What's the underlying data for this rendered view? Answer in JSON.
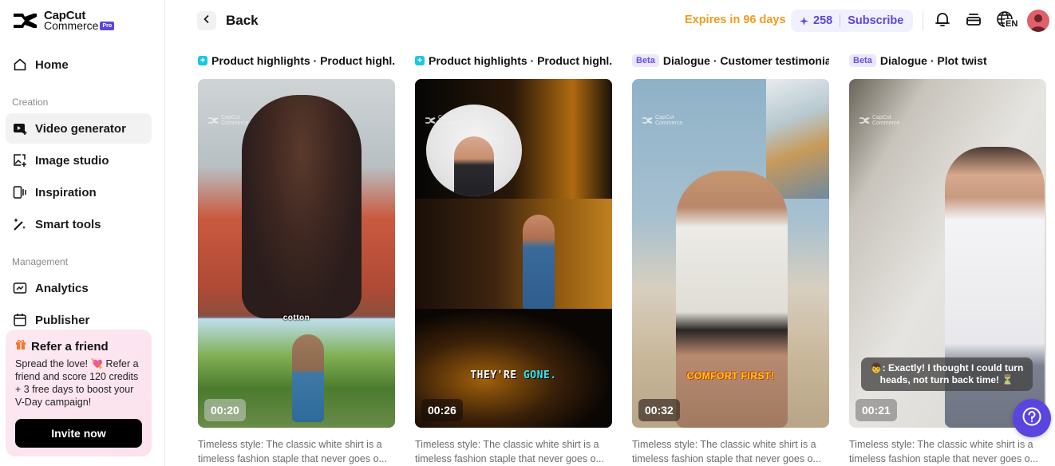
{
  "brand": {
    "name_line1": "CapCut",
    "name_line2": "Commerce",
    "badge": "Pro"
  },
  "sidebar": {
    "home": {
      "label": "Home",
      "icon": "home-icon"
    },
    "sections": [
      {
        "title": "Creation"
      },
      {
        "title": "Management"
      }
    ],
    "items": [
      {
        "label": "Video generator",
        "icon": "video-generator-icon",
        "active": true
      },
      {
        "label": "Image studio",
        "icon": "image-studio-icon"
      },
      {
        "label": "Inspiration",
        "icon": "inspiration-icon"
      },
      {
        "label": "Smart tools",
        "icon": "magic-wand-icon"
      },
      {
        "label": "Analytics",
        "icon": "analytics-icon"
      },
      {
        "label": "Publisher",
        "icon": "calendar-icon"
      }
    ],
    "refer": {
      "title": "Refer a friend",
      "text": "Spread the love! 💘 Refer a friend and score 120 credits + 3 free days to boost your V-Day campaign!",
      "button": "Invite now"
    }
  },
  "topbar": {
    "back_label": "Back",
    "expires": "Expires in 96 days",
    "credits": "258",
    "subscribe": "Subscribe",
    "language": "EN"
  },
  "cards": [
    {
      "badge_type": "plus",
      "badge": "+",
      "title": "Product highlights · Product highl...",
      "duration": "00:20",
      "caption": "cotton",
      "description": "Timeless style: The classic white shirt is a timeless fashion staple that never goes o..."
    },
    {
      "badge_type": "plus",
      "badge": "+",
      "title": "Product highlights · Product highl...",
      "duration": "00:26",
      "caption_part1": "THEY'RE ",
      "caption_part2": "GONE.",
      "description": "Timeless style: The classic white shirt is a timeless fashion staple that never goes o..."
    },
    {
      "badge_type": "beta",
      "badge": "Beta",
      "title": "Dialogue · Customer testimonial",
      "duration": "00:32",
      "caption": "COMFORT FIRST!",
      "description": "Timeless style: The classic white shirt is a timeless fashion staple that never goes o..."
    },
    {
      "badge_type": "beta",
      "badge": "Beta",
      "title": "Dialogue · Plot twist",
      "duration": "00:21",
      "caption": "👦: Exactly! I thought I could turn heads, not turn back time! ⏳",
      "description": "Timeless style: The classic white shirt is a timeless fashion staple that never goes o..."
    }
  ],
  "watermark": {
    "line1": "CapCut",
    "line2": "Commerce"
  },
  "colors": {
    "accent": "#5a45e0",
    "expires": "#f39a1f",
    "plus_badge": "#18c7e6",
    "beta_text": "#6a4fe0"
  }
}
